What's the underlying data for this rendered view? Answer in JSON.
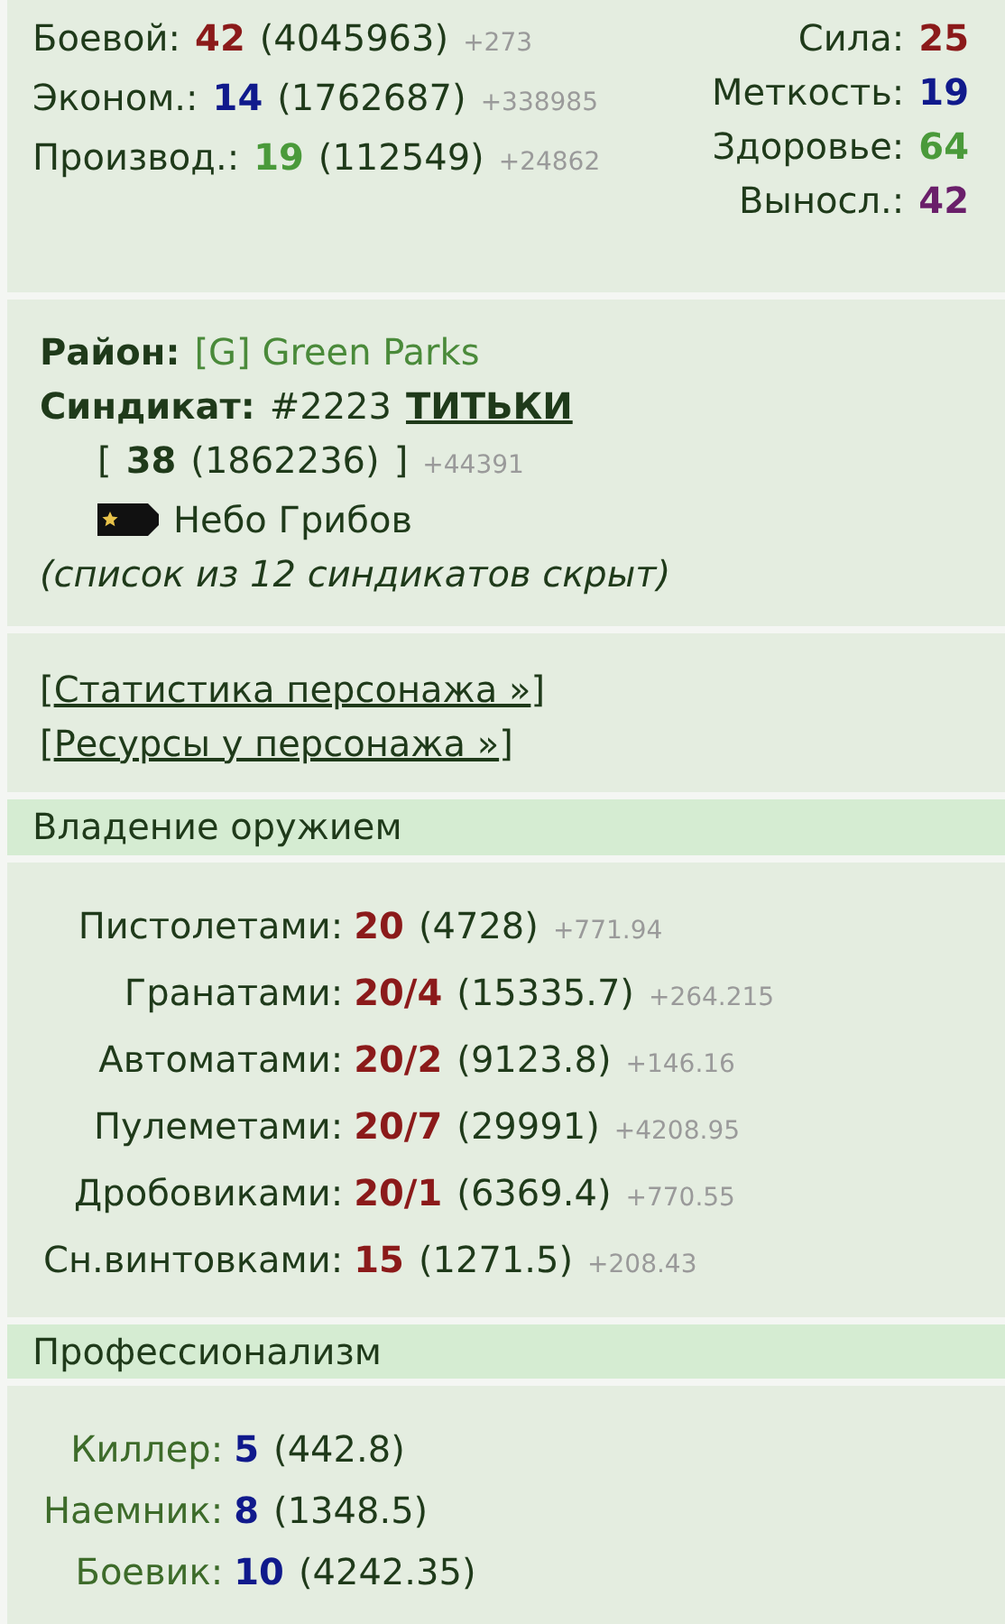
{
  "skills": [
    {
      "label": "Боевой:",
      "value": "42",
      "color": "#8b1a1a",
      "total": "(4045963)",
      "delta": "+273"
    },
    {
      "label": "Эконом.:",
      "value": "14",
      "color": "#101a8c",
      "total": "(1762687)",
      "delta": "+338985"
    },
    {
      "label": "Производ.:",
      "value": "19",
      "color": "#4a9a3a",
      "total": "(112549)",
      "delta": "+24862"
    }
  ],
  "attributes": [
    {
      "label": "Сила:",
      "value": "25",
      "color": "#8b1a1a"
    },
    {
      "label": "Меткость:",
      "value": "19",
      "color": "#101a8c"
    },
    {
      "label": "Здоровье:",
      "value": "64",
      "color": "#4a9a3a"
    },
    {
      "label": "Выносл.:",
      "value": "42",
      "color": "#6a1f6a"
    }
  ],
  "district": {
    "label": "Район:",
    "value": "[G] Green Parks"
  },
  "syndicate": {
    "label": "Синдикат:",
    "number": "#2223",
    "name": "ТИТЬКИ",
    "open_bracket": "[",
    "level": "38",
    "total": "(1862236)",
    "close_bracket": "]",
    "delta": "+44391",
    "rank": "Небо Грибов",
    "note": "(список из 12 синдикатов скрыт)"
  },
  "links": [
    {
      "open": "[",
      "label": "Статистика персонажа »",
      "close": "]"
    },
    {
      "open": "[",
      "label": "Ресурсы у персонажа »",
      "close": "]"
    }
  ],
  "weapons": {
    "title": "Владение оружием",
    "rows": [
      {
        "label": "Пистолетами:",
        "value": "20",
        "total": "(4728)",
        "delta": "+771.94"
      },
      {
        "label": "Гранатами:",
        "value": "20/4",
        "total": "(15335.7)",
        "delta": "+264.215"
      },
      {
        "label": "Автоматами:",
        "value": "20/2",
        "total": "(9123.8)",
        "delta": "+146.16"
      },
      {
        "label": "Пулеметами:",
        "value": "20/7",
        "total": "(29991)",
        "delta": "+4208.95"
      },
      {
        "label": "Дробовиками:",
        "value": "20/1",
        "total": "(6369.4)",
        "delta": "+770.55"
      },
      {
        "label": "Сн.винтовками:",
        "value": "15",
        "total": "(1271.5)",
        "delta": "+208.43"
      }
    ]
  },
  "professions": {
    "title": "Профессионализм",
    "rows": [
      {
        "label": "Киллер:",
        "value": "5",
        "total": "(442.8)"
      },
      {
        "label": "Наемник:",
        "value": "8",
        "total": "(1348.5)"
      },
      {
        "label": "Боевик:",
        "value": "10",
        "total": "(4242.35)"
      }
    ]
  }
}
